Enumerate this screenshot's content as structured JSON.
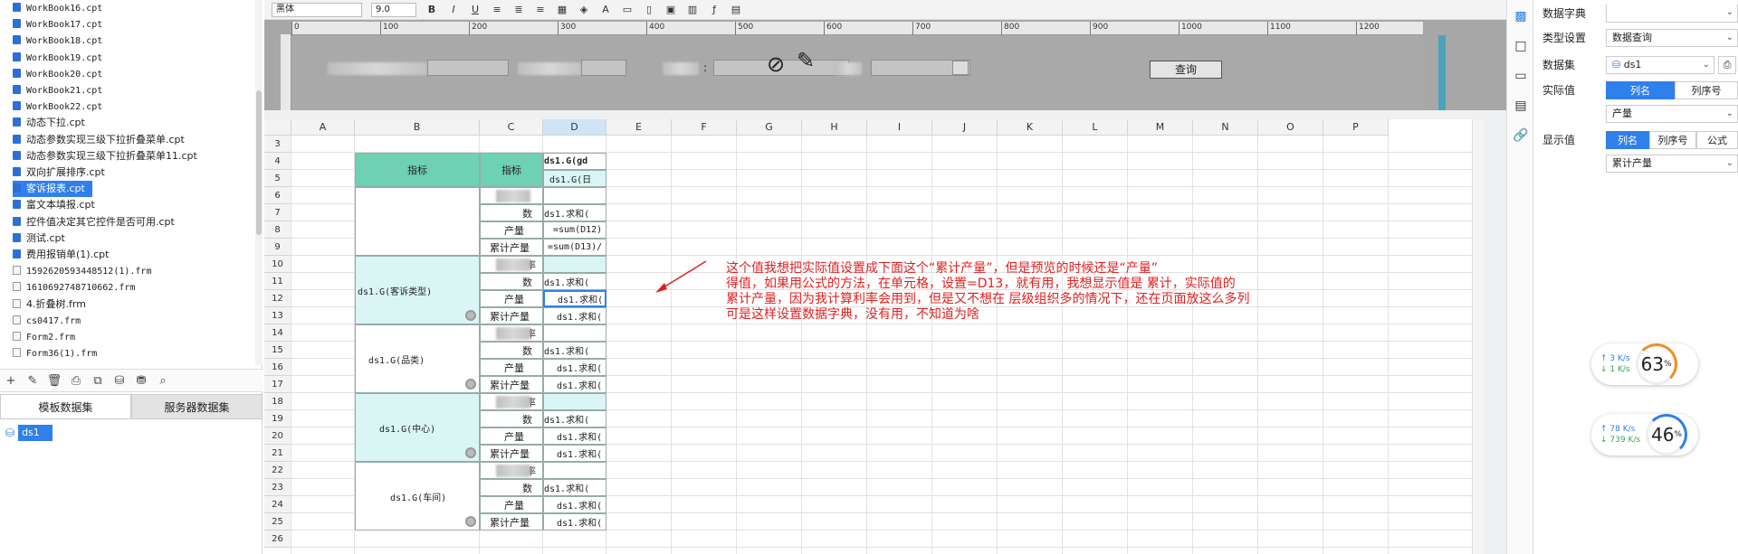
{
  "files": [
    {
      "name": "WorkBook16.cpt",
      "type": "cpt"
    },
    {
      "name": "WorkBook17.cpt",
      "type": "cpt"
    },
    {
      "name": "WorkBook18.cpt",
      "type": "cpt"
    },
    {
      "name": "WorkBook19.cpt",
      "type": "cpt"
    },
    {
      "name": "WorkBook20.cpt",
      "type": "cpt"
    },
    {
      "name": "WorkBook21.cpt",
      "type": "cpt"
    },
    {
      "name": "WorkBook22.cpt",
      "type": "cpt"
    },
    {
      "name": "动态下拉.cpt",
      "type": "cpt"
    },
    {
      "name": "动态参数实现三级下拉折叠菜单.cpt",
      "type": "cpt"
    },
    {
      "name": "动态参数实现三级下拉折叠菜单11.cpt",
      "type": "cpt"
    },
    {
      "name": "双向扩展排序.cpt",
      "type": "cpt"
    },
    {
      "name": "客诉报表.cpt",
      "type": "cpt",
      "selected": true
    },
    {
      "name": "富文本填报.cpt",
      "type": "cpt"
    },
    {
      "name": "控件值决定其它控件是否可用.cpt",
      "type": "cpt"
    },
    {
      "name": "测试.cpt",
      "type": "cpt"
    },
    {
      "name": "费用报销单(1).cpt",
      "type": "cpt"
    },
    {
      "name": "1592620593448512(1).frm",
      "type": "frm"
    },
    {
      "name": "1610692748710662.frm",
      "type": "frm"
    },
    {
      "name": "4.折叠树.frm",
      "type": "frm"
    },
    {
      "name": "cs0417.frm",
      "type": "frm"
    },
    {
      "name": "Form2.frm",
      "type": "frm"
    },
    {
      "name": "Form36(1).frm",
      "type": "frm"
    }
  ],
  "dataset_tabs": {
    "template": "模板数据集",
    "server": "服务器数据集"
  },
  "dataset_item": "ds1",
  "format": {
    "font": "黑体",
    "size": "9.0"
  },
  "ruler_labels": [
    "0",
    "100",
    "200",
    "300",
    "400",
    "500",
    "600",
    "700",
    "800",
    "900",
    "1000",
    "1100",
    "1200"
  ],
  "param_query_label": "查询",
  "param_colon": ":",
  "columns": [
    "A",
    "B",
    "C",
    "D",
    "E",
    "F",
    "G",
    "H",
    "I",
    "J",
    "K",
    "L",
    "M",
    "N",
    "O",
    "P"
  ],
  "rows": [
    "3",
    "4",
    "5",
    "6",
    "7",
    "8",
    "9",
    "10",
    "11",
    "12",
    "13",
    "14",
    "15",
    "16",
    "17",
    "18",
    "19",
    "20",
    "21",
    "22",
    "23",
    "24",
    "25",
    "26"
  ],
  "cells": {
    "b4": "指标",
    "c4": "指标",
    "d4": "ds1.G(gd",
    "d5": "ds1.G(日",
    "c7": "数",
    "d7": "ds1.求和(",
    "c8": "产量",
    "d8": "=sum(D12)",
    "c9": "累计产量",
    "d9": "=sum(D13)/",
    "b11": "ds1.G(客诉类型)",
    "c10": "率",
    "c11": "数",
    "d11": "ds1.求和(",
    "c12": "产量",
    "d12": "ds1.求和(",
    "c13": "累计产量",
    "d13": "ds1.求和(",
    "b15": "ds1.G(品类)",
    "c14": "率",
    "c15": "数",
    "d15": "ds1.求和(",
    "c16": "产量",
    "d16": "ds1.求和(",
    "c17": "累计产量",
    "d17": "ds1.求和(",
    "b20": "ds1.G(中心)",
    "c18": "率",
    "c19": "数",
    "d19": "ds1.求和(",
    "c20": "产量",
    "d20": "ds1.求和(",
    "c21": "累计产量",
    "d21": "ds1.求和(",
    "b24": "ds1.G(车间)",
    "c22": "率",
    "c23": "数",
    "d23": "ds1.求和(",
    "c24": "产量",
    "d24": "ds1.求和(",
    "c25": "累计产量",
    "d25": "ds1.求和("
  },
  "note": [
    "这个值我想把实际值设置成下面这个“累计产量”，但是预览的时候还是“产量”",
    "得值，如果用公式的方法，在单元格，设置=D13，就有用，我想显示值是 累计，实际值的",
    "累计产量，因为我计算利率会用到，但是又不想在 层级组织多的情况下，还在页面放这么多列",
    "可是这样设置数据字典，没有用，不知道为啥"
  ],
  "props": {
    "dict_label": "数据字典",
    "type_label": "类型设置",
    "type_value": "数据查询",
    "dataset_label": "数据集",
    "dataset_value": "ds1",
    "actual_label": "实际值",
    "actual_seg": [
      "列名",
      "列序号"
    ],
    "actual_value": "产量",
    "display_label": "显示值",
    "display_seg": [
      "列名",
      "列序号",
      "公式"
    ],
    "display_value": "累计产量"
  },
  "net": [
    {
      "up": "3  K/s",
      "down": "1  K/s",
      "pct": "63",
      "unit": "%"
    },
    {
      "up": "78  K/s",
      "down": "739 K/s",
      "pct": "46",
      "unit": "%"
    }
  ],
  "colors": {
    "accent": "#2f80ed",
    "header_fill": "#6ed1b4",
    "group_fill": "#d9f6f5",
    "note": "#e02020"
  }
}
